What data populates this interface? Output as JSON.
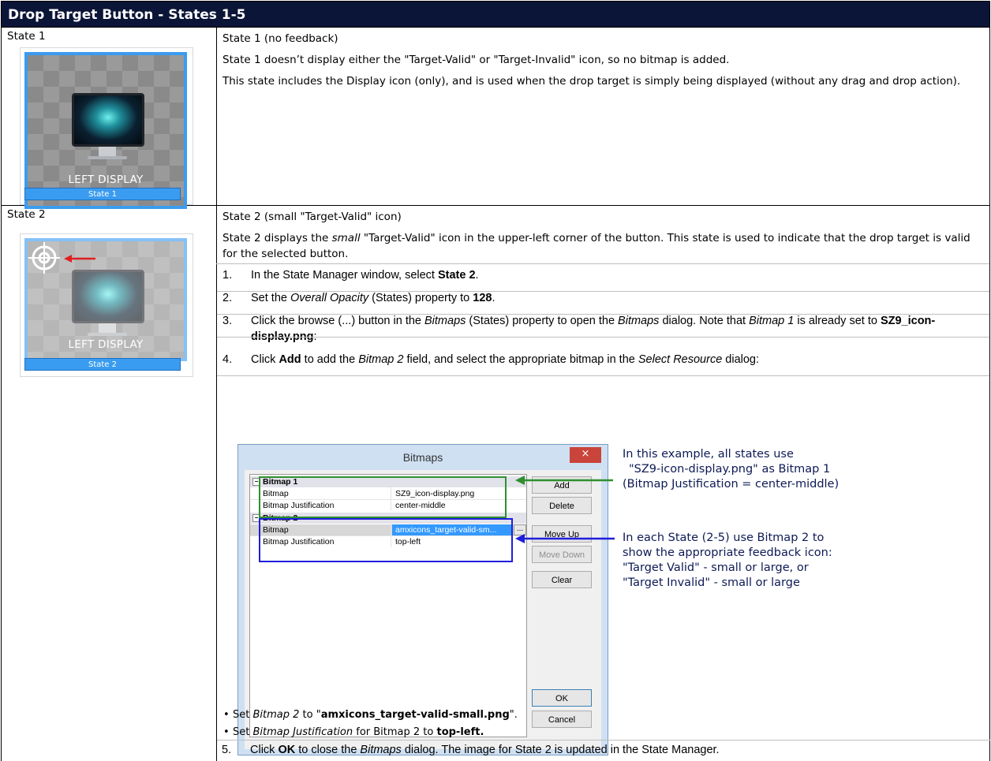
{
  "title": "Drop Target Button - States 1-5",
  "row1": {
    "label": "State 1",
    "thumb_label": "LEFT DISPLAY",
    "thumb_state": "State 1",
    "heading": "State 1 (no feedback)",
    "p1": "State 1 doesn’t display either the \"Target-Valid\" or \"Target-Invalid\" icon, so no bitmap is added.",
    "p2": "This state includes the Display icon (only), and is used when the drop target is simply being displayed (without any drag and drop action)."
  },
  "row2": {
    "label": "State 2",
    "thumb_label": "LEFT DISPLAY",
    "thumb_state": "State 2",
    "heading": "State 2 (small \"Target-Valid\" icon)",
    "p1_a": "State 2 displays the ",
    "p1_b": "small",
    "p1_c": " \"Target-Valid\" icon in the upper-left corner of the button. This state is used to indicate that the drop target is valid for the selected button.",
    "steps": [
      {
        "num": "1.",
        "a": "In the State Manager window, select ",
        "b": "State 2",
        "c": "."
      },
      {
        "num": "2.",
        "a": "Set the ",
        "i": "Overall Opacity",
        "c": " (States) property to ",
        "b": "128",
        "d": "."
      },
      {
        "num": "3.",
        "a": "Click the browse (...) button in the ",
        "i": "Bitmaps",
        "c": " (States) property to open the ",
        "i2": "Bitmaps",
        "d": " dialog. Note that ",
        "i3": "Bitmap 1",
        "e": " is already set to ",
        "b": "SZ9_icon-display.png",
        "f": ":"
      },
      {
        "num": "4.",
        "a": "Click ",
        "b": "Add",
        "c": " to add the ",
        "i": "Bitmap 2",
        "d": " field, and select the appropriate bitmap in the ",
        "i2": "Select Resource",
        "e": " dialog:"
      },
      {
        "num": "5.",
        "a": "Click ",
        "b": "OK",
        "c": " to close the ",
        "i": "Bitmaps",
        "d": " dialog. The image for State 2 is updated in the State Manager."
      }
    ],
    "bullets": [
      {
        "a": "Set ",
        "i": "Bitmap 2",
        "c": " to \"",
        "b": "amxicons_target-valid-small.png",
        "d": "\"."
      },
      {
        "a": "Set ",
        "i": "Bitmap Justification",
        "c": " for Bitmap 2 to ",
        "b": "top-left."
      }
    ]
  },
  "dialog": {
    "title": "Bitmaps",
    "close": "×",
    "bitmap1_header": "Bitmap 1",
    "bitmap1_key": "Bitmap",
    "bitmap1_value": "SZ9_icon-display.png",
    "just1_key": "Bitmap Justification",
    "just1_value": "center-middle",
    "bitmap2_header": "Bitmap 2",
    "bitmap2_key": "Bitmap",
    "bitmap2_value": "amxicons_target-valid-sm...",
    "dots": "...",
    "just2_key": "Bitmap Justification",
    "just2_value": "top-left",
    "buttons": {
      "add": "Add",
      "delete": "Delete",
      "move_up": "Move Up",
      "move_down": "Move Down",
      "clear": "Clear",
      "ok": "OK",
      "cancel": "Cancel"
    }
  },
  "callouts": {
    "green": [
      "In this example, all states use",
      "\"SZ9-icon-display.png\" as Bitmap 1",
      "(Bitmap Justification = center-middle)"
    ],
    "blue": [
      "In each State (2-5) use Bitmap 2 to",
      "show the appropriate feedback icon:",
      "\"Target Valid\" - small or large, or",
      "\"Target Invalid\" - small or large"
    ]
  },
  "colors": {
    "title_bg": "#0b1537",
    "accent_blue": "#3a9cf0",
    "callout_green": "#2f8f2f",
    "callout_blue": "#1e1edc",
    "arrow_red": "#e02020"
  }
}
